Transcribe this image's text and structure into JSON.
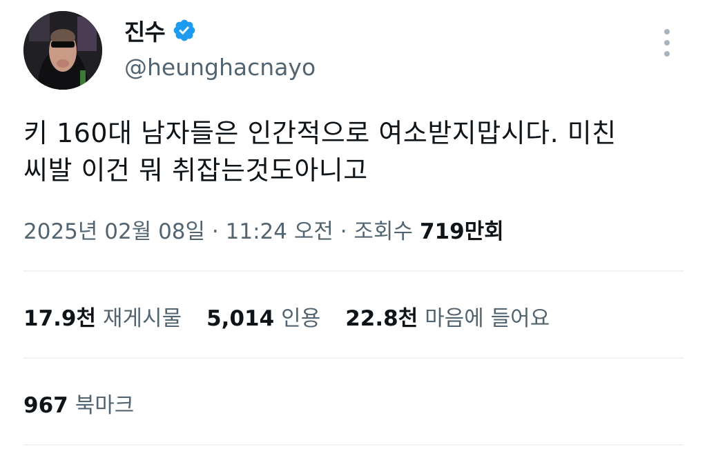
{
  "author": {
    "display_name": "진수",
    "handle": "@heunghacnayo",
    "verified_icon": "verified-badge-icon",
    "badge_color": "#1d9bf0"
  },
  "tweet": {
    "line1": "키 160대 남자들은 인간적으로 여소받지맙시다. 미친",
    "line2": "씨발 이건 뭐 취잡는것도아니고"
  },
  "meta": {
    "date": "2025년 02월 08일",
    "sep1": " · ",
    "time": "11:24 오전",
    "sep2": " · ",
    "views_label": "조회수",
    "views_value": "719",
    "views_unit": "만회"
  },
  "stats": {
    "retweets": {
      "value": "17.9천",
      "label": "재게시물"
    },
    "quotes": {
      "value": "5,014",
      "label": "인용"
    },
    "likes": {
      "value": "22.8천",
      "label": "마음에 들어요"
    }
  },
  "bookmarks": {
    "value": "967",
    "label": "북마크"
  },
  "colors": {
    "text": "#0f1419",
    "secondary": "#536471",
    "divider": "#eff3f4"
  }
}
